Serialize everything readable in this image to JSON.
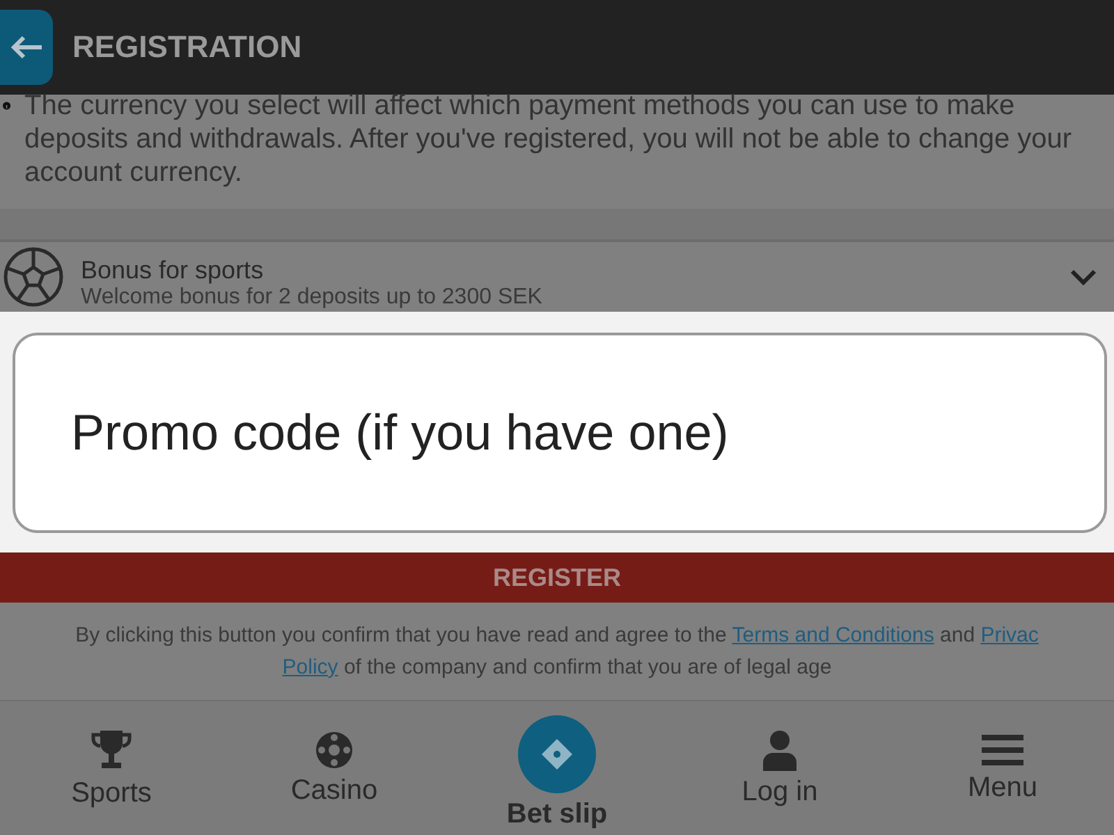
{
  "header": {
    "title": "REGISTRATION"
  },
  "currency_notice": "The currency you select will affect which payment methods you can use to make deposits and withdrawals. After you've registered, you will not be able to change your account currency.",
  "bonus": {
    "title": "Bonus for sports",
    "subtitle": "Welcome bonus for 2 deposits up to 2300 SEK",
    "expanded": false
  },
  "promo_field": {
    "placeholder": "Promo code (if you have one)"
  },
  "register_button": "REGISTER",
  "terms": {
    "before": "By clicking this button you confirm that you have read and agree to the",
    "link1": "Terms and Conditions",
    "middle": "and",
    "link2": "Privac",
    "link2_rest": "Policy",
    "after": "of the company and confirm that you are of legal age"
  },
  "nav": [
    {
      "kind": "trophy",
      "label": "Sports",
      "selected": false
    },
    {
      "kind": "ball",
      "label": "Casino",
      "selected": false
    },
    {
      "kind": "ticket",
      "label": "Bet slip",
      "selected": true
    },
    {
      "kind": "person",
      "label": "Log in",
      "selected": false
    },
    {
      "kind": "menu",
      "label": "Menu",
      "selected": false
    }
  ]
}
